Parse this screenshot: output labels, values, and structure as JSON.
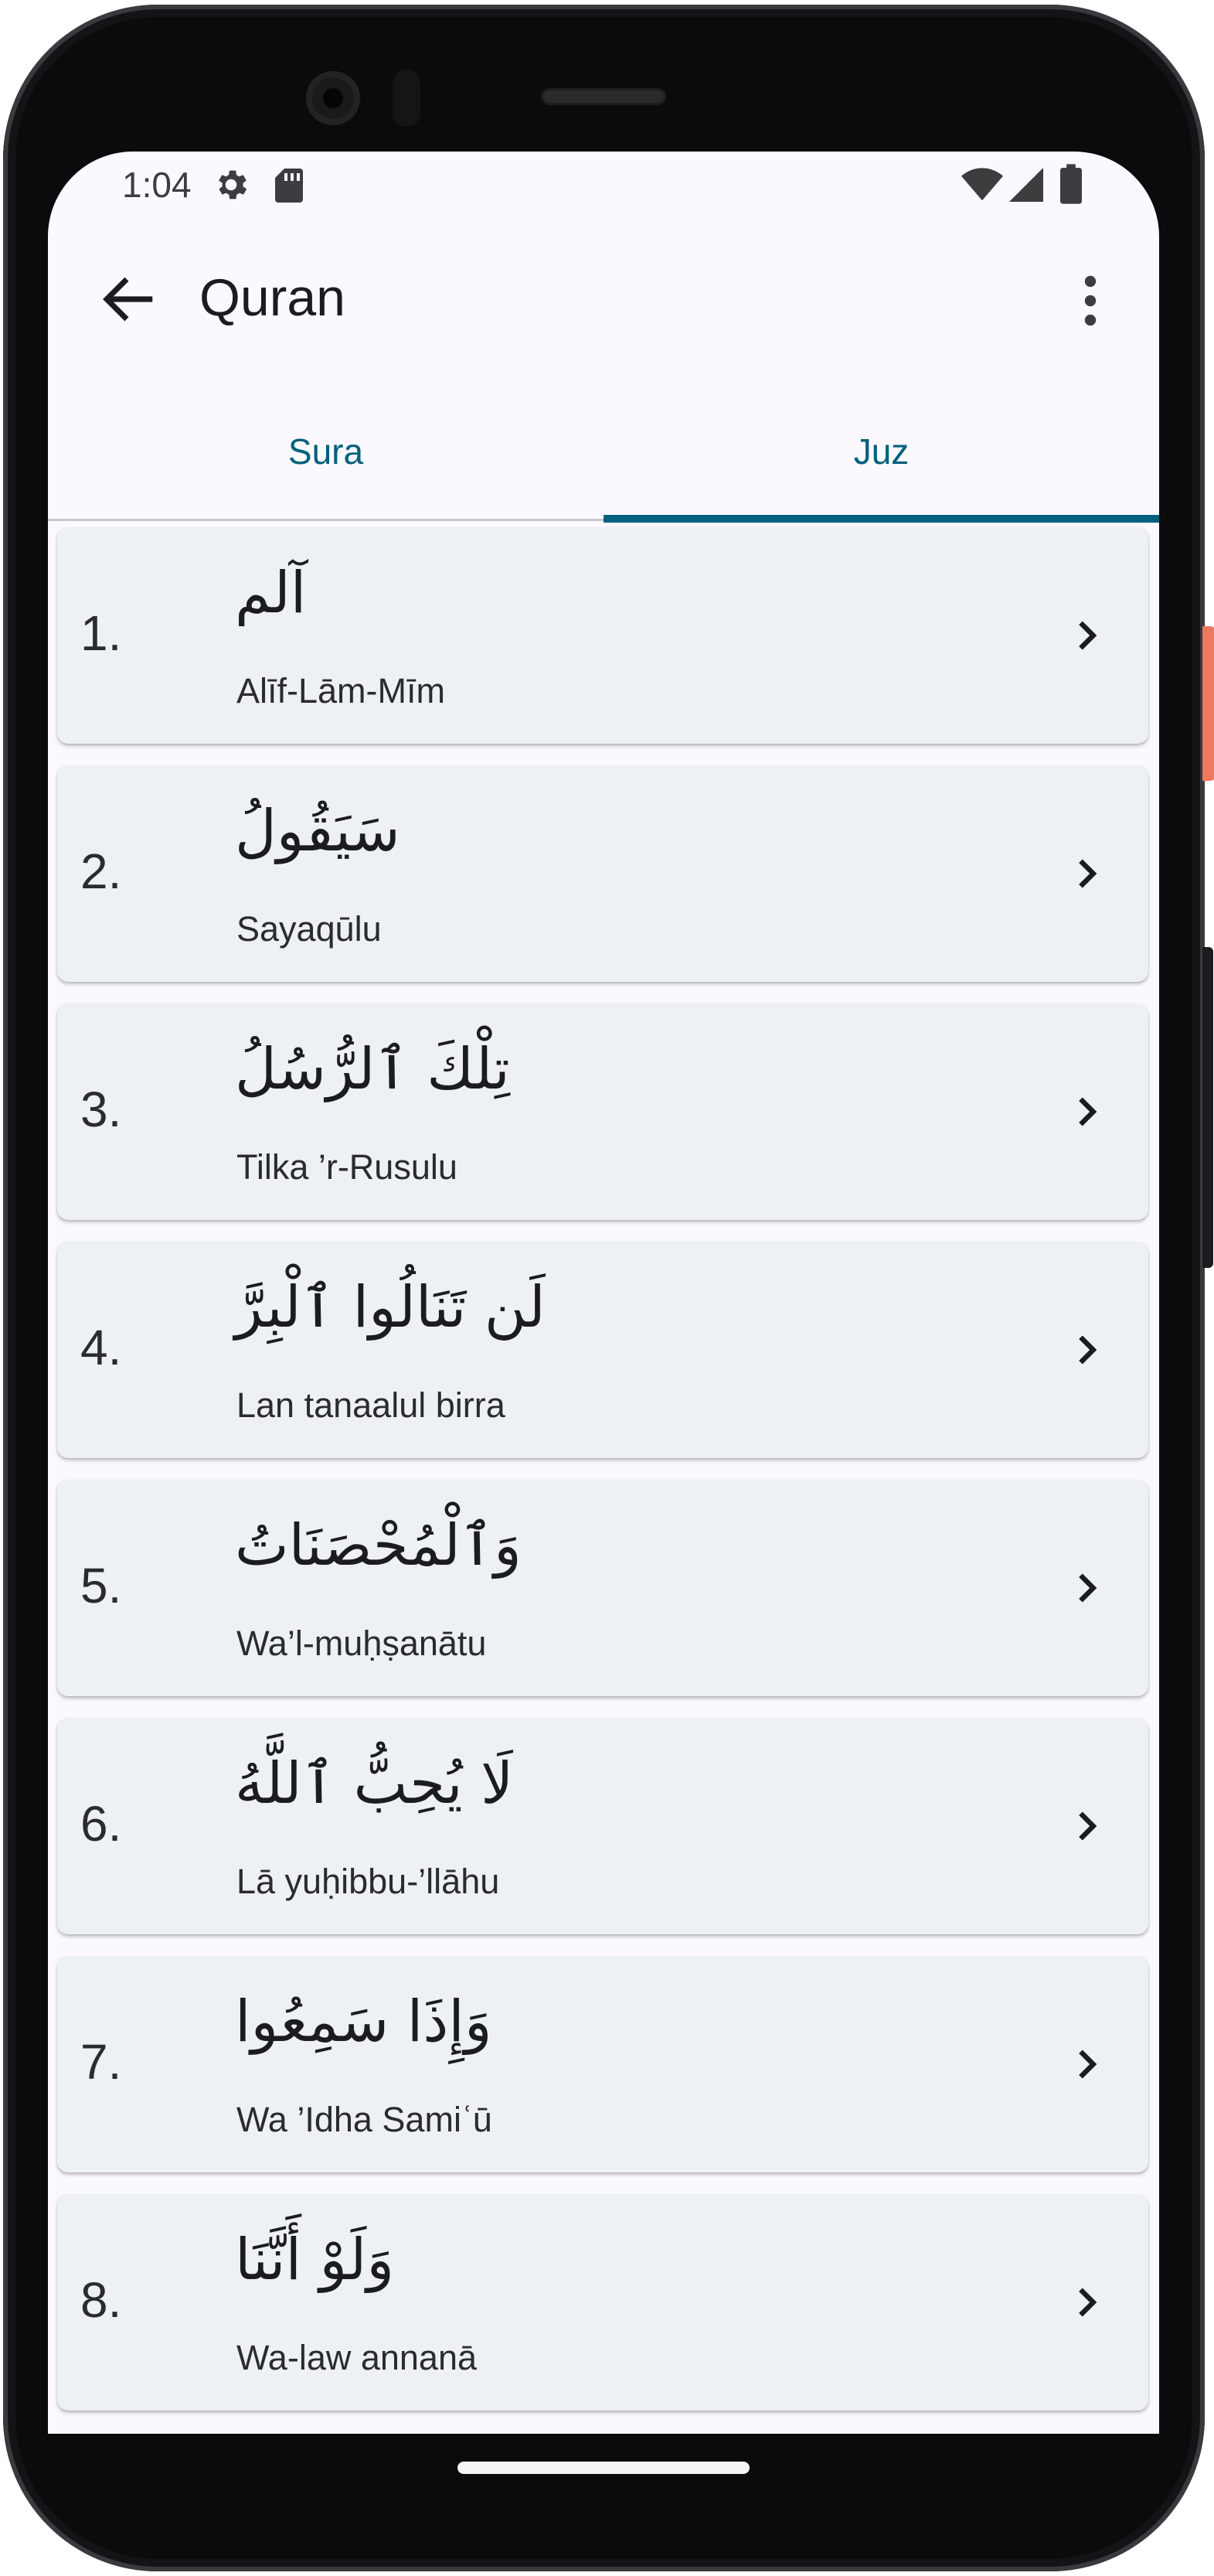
{
  "status": {
    "time": "1:04",
    "icons": [
      "gear-icon",
      "sd-card-icon",
      "wifi-icon",
      "signal-icon",
      "battery-icon"
    ]
  },
  "app_bar": {
    "title": "Quran",
    "back_icon": "arrow-back-icon",
    "menu_icon": "more-vert-icon"
  },
  "tabs": [
    {
      "label": "Sura",
      "selected": false
    },
    {
      "label": "Juz",
      "selected": true
    }
  ],
  "juz_list": [
    {
      "number": "1.",
      "arabic": "آلم",
      "translit": "Alīf-Lām-Mīm"
    },
    {
      "number": "2.",
      "arabic": "سَيَقُولُ",
      "translit": "Sayaqūlu"
    },
    {
      "number": "3.",
      "arabic": "تِلْكَ ٱلرُّسُلُ",
      "translit": "Tilka ’r-Rusulu"
    },
    {
      "number": "4.",
      "arabic": "لَن تَنَالُوا ٱلْبِرَّ",
      "translit": "Lan tanaalul birra"
    },
    {
      "number": "5.",
      "arabic": "وَٱلْمُحْصَنَاتُ",
      "translit": "Wa’l-muḥṣanātu"
    },
    {
      "number": "6.",
      "arabic": "لَا يُحِبُّ ٱللَّهُ",
      "translit": "Lā yuḥibbu-’llāhu"
    },
    {
      "number": "7.",
      "arabic": "وَإِذَا سَمِعُوا",
      "translit": "Wa ’Idha Samiʿū"
    },
    {
      "number": "8.",
      "arabic": "وَلَوْ أَنَّنَا",
      "translit": "Wa-law annanā"
    }
  ],
  "colors": {
    "accent": "#00607e",
    "card_bg": "#edf0f5",
    "screen_bg": "#fbf9fd"
  }
}
